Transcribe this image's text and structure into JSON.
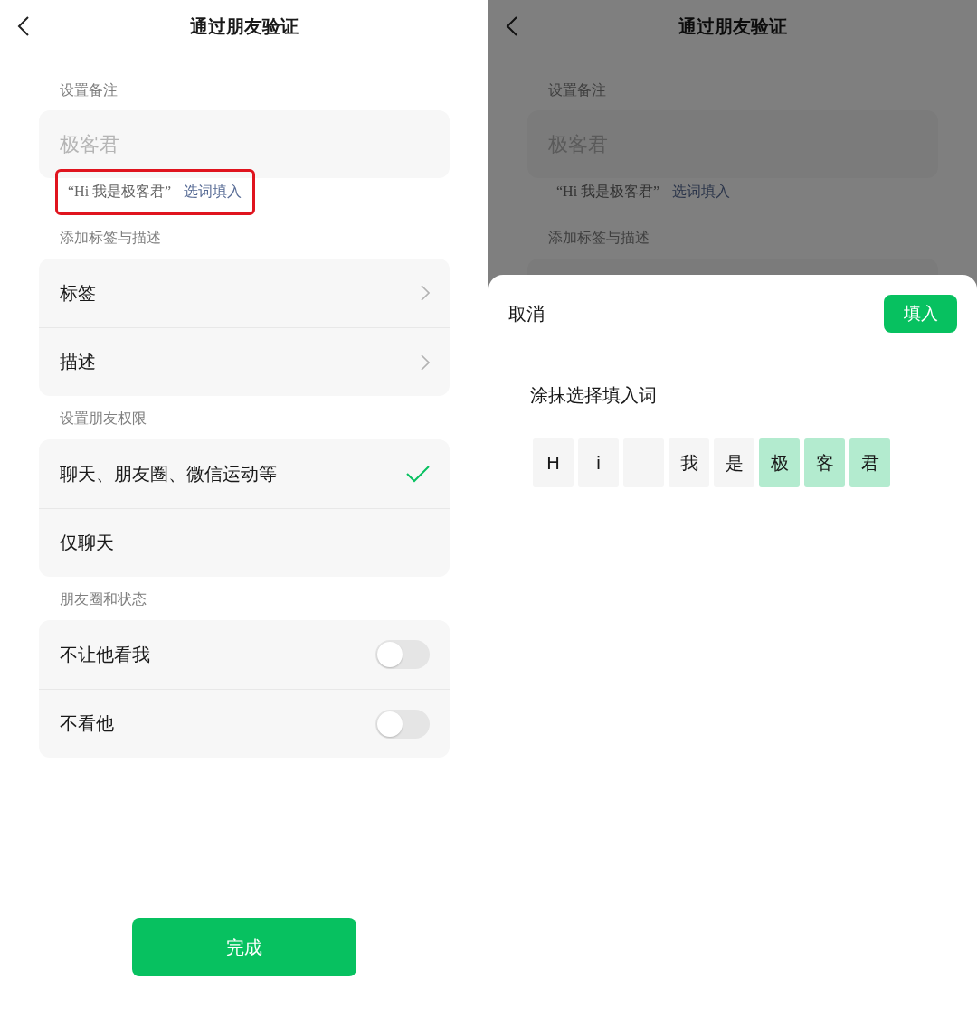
{
  "left_screen": {
    "title": "通过朋友验证",
    "remark": {
      "label": "设置备注",
      "value": "极客君",
      "suggestion": "“Hi 我是极客君”",
      "suggestion_link": "选词填入",
      "highlighted": true
    },
    "tags": {
      "label": "添加标签与描述",
      "rows": [
        {
          "label": "标签"
        },
        {
          "label": "描述"
        }
      ]
    },
    "permissions": {
      "label": "设置朋友权限",
      "options": [
        {
          "label": "聊天、朋友圈、微信运动等",
          "selected": true
        },
        {
          "label": "仅聊天",
          "selected": false
        }
      ]
    },
    "moments": {
      "label": "朋友圈和状态",
      "toggles": [
        {
          "label": "不让他看我",
          "on": false
        },
        {
          "label": "不看他",
          "on": false
        }
      ]
    },
    "done_button": "完成"
  },
  "right_screen": {
    "dimmed": true,
    "background": {
      "title": "通过朋友验证",
      "remark": {
        "label": "设置备注",
        "value": "极客君",
        "suggestion": "“Hi 我是极客君”",
        "suggestion_link": "选词填入",
        "highlighted": false
      },
      "next_label": "添加标签与描述"
    },
    "sheet": {
      "cancel": "取消",
      "confirm": "填入",
      "prompt": "涂抹选择填入词",
      "tiles": [
        {
          "kind": "char",
          "char": "H",
          "selected": false
        },
        {
          "kind": "char",
          "char": "i",
          "selected": false
        },
        {
          "kind": "space",
          "selected": false
        },
        {
          "kind": "char",
          "char": "我",
          "selected": false
        },
        {
          "kind": "char",
          "char": "是",
          "selected": false
        },
        {
          "kind": "char",
          "char": "极",
          "selected": true
        },
        {
          "kind": "char",
          "char": "客",
          "selected": true
        },
        {
          "kind": "char",
          "char": "君",
          "selected": true
        }
      ]
    }
  }
}
